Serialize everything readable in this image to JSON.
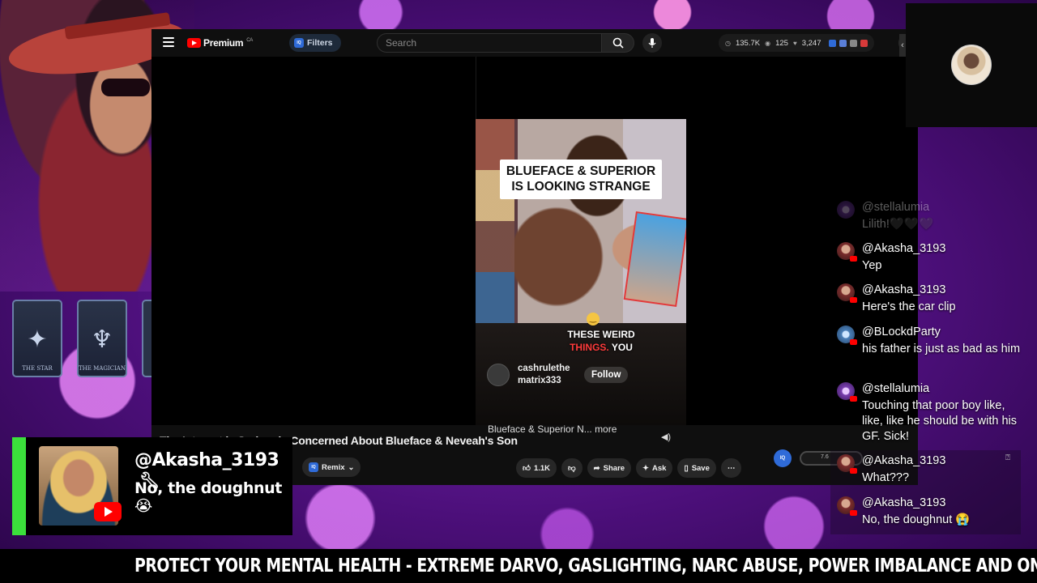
{
  "decor": {
    "tarot": [
      {
        "label": "THE STAR",
        "glyph": "✦"
      },
      {
        "label": "THE MAGICIAN",
        "glyph": "♆"
      }
    ]
  },
  "youtube": {
    "logo": "Premium",
    "region": "CA",
    "filters_label": "Filters",
    "iq_badge": "IQ",
    "search_placeholder": "Search",
    "stats": {
      "views": "135.7K",
      "viewers": "125",
      "likes": "3,247"
    }
  },
  "video": {
    "caption": "BLUEFACE & SUPERIOR IS LOOKING STRANGE",
    "overlay_line1": "THESE WEIRD",
    "overlay_red": "THINGS.",
    "overlay_rest": "YOU",
    "channel": "cashrulethe matrix333",
    "follow_label": "Follow",
    "short_desc": "Blueface & Superior N... more",
    "title": "The Internet is Seriously Concerned About Blueface & Neveah's Son"
  },
  "actions": {
    "remix": "Remix",
    "likes": "1.1K",
    "share": "Share",
    "ask": "Ask",
    "save": "Save",
    "progress_value": "7.6"
  },
  "chat": {
    "messages": [
      {
        "user": "@stellalumia",
        "text": "Lilith!🖤🖤🖤",
        "avatar": "purple"
      },
      {
        "user": "@Akasha_3193",
        "text": "Yep",
        "avatar": "red"
      },
      {
        "user": "@Akasha_3193",
        "text": "Here's the car clip",
        "avatar": "red"
      },
      {
        "user": "@BLockdParty",
        "text": "his father is just as bad as him",
        "avatar": "blue"
      },
      {
        "user": "@stellalumia",
        "text": "Touching that poor boy like, like, like he should be with his GF. Sick!",
        "avatar": "purple"
      },
      {
        "user": "@Akasha_3193",
        "text": "What???",
        "avatar": "red"
      },
      {
        "user": "@Akasha_3193",
        "text": "No, the doughnut 😭",
        "avatar": "red"
      }
    ]
  },
  "highlight": {
    "user": "@Akasha_3193",
    "text": "No, the doughnut 😭"
  },
  "ticker": {
    "text": "PROTECT YOUR MENTAL HEALTH - EXTREME DARVO, GASLIGHTING, NARC ABUSE, POWER IMBALANCE AND ON"
  },
  "colors": {
    "accent_green": "#3be03b",
    "youtube_red": "#ff0000",
    "background_purple": "#4c0f7a"
  }
}
